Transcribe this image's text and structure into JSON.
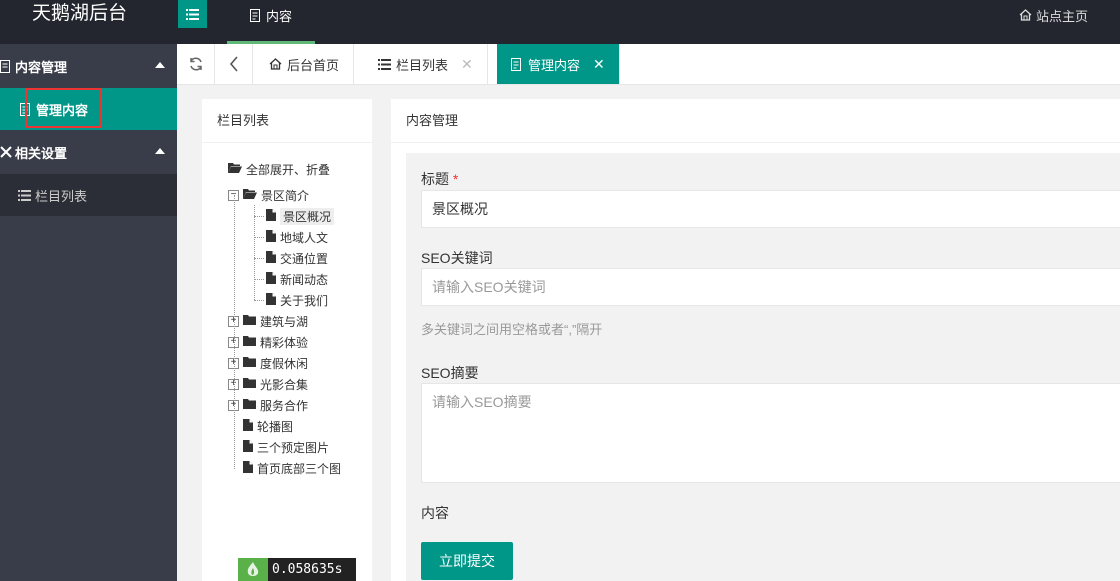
{
  "app": {
    "title": "天鹅湖后台",
    "top_tab_label": "内容",
    "site_home_label": "站点主页"
  },
  "sidebar": {
    "groups": [
      {
        "label": "内容管理",
        "items": [
          {
            "label": "管理内容",
            "active": true
          }
        ]
      },
      {
        "label": "相关设置",
        "items": [
          {
            "label": "栏目列表",
            "active": false
          }
        ]
      }
    ]
  },
  "tabs": [
    {
      "label": "后台首页",
      "icon": "home-icon",
      "closable": false,
      "active": false
    },
    {
      "label": "栏目列表",
      "icon": "list-icon",
      "closable": true,
      "active": false
    },
    {
      "label": "管理内容",
      "icon": "edit-doc-icon",
      "closable": true,
      "active": true
    }
  ],
  "tree_panel": {
    "title": "栏目列表",
    "toggle_all": "全部展开、折叠",
    "nodes": [
      {
        "label": "景区简介",
        "type": "folder-open",
        "expanded": true
      },
      {
        "label": "景区概况",
        "type": "file",
        "child": true,
        "selected": true
      },
      {
        "label": "地域人文",
        "type": "file",
        "child": true
      },
      {
        "label": "交通位置",
        "type": "file",
        "child": true
      },
      {
        "label": "新闻动态",
        "type": "file",
        "child": true
      },
      {
        "label": "关于我们",
        "type": "file",
        "child": true
      },
      {
        "label": "建筑与湖",
        "type": "folder",
        "expanded": false
      },
      {
        "label": "精彩体验",
        "type": "folder",
        "expanded": false
      },
      {
        "label": "度假休闲",
        "type": "folder",
        "expanded": false
      },
      {
        "label": "光影合集",
        "type": "folder",
        "expanded": false
      },
      {
        "label": "服务合作",
        "type": "folder",
        "expanded": false
      },
      {
        "label": "轮播图",
        "type": "file"
      },
      {
        "label": "三个预定图片",
        "type": "file"
      },
      {
        "label": "首页底部三个图",
        "type": "file"
      }
    ]
  },
  "content_panel": {
    "title": "内容管理",
    "form": {
      "title_label": "标题",
      "title_required_mark": "*",
      "title_value": "景区概况",
      "seo_keywords_label": "SEO关键词",
      "seo_keywords_placeholder": "请输入SEO关键词",
      "seo_keywords_hint": "多关键词之间用空格或者“,”隔开",
      "seo_summary_label": "SEO摘要",
      "seo_summary_placeholder": "请输入SEO摘要",
      "content_label": "内容",
      "submit_label": "立即提交"
    }
  },
  "timer": {
    "value": "0.058635s"
  },
  "colors": {
    "accent": "#009688",
    "header_bg": "#23262e",
    "sidebar_bg": "#393d49"
  }
}
